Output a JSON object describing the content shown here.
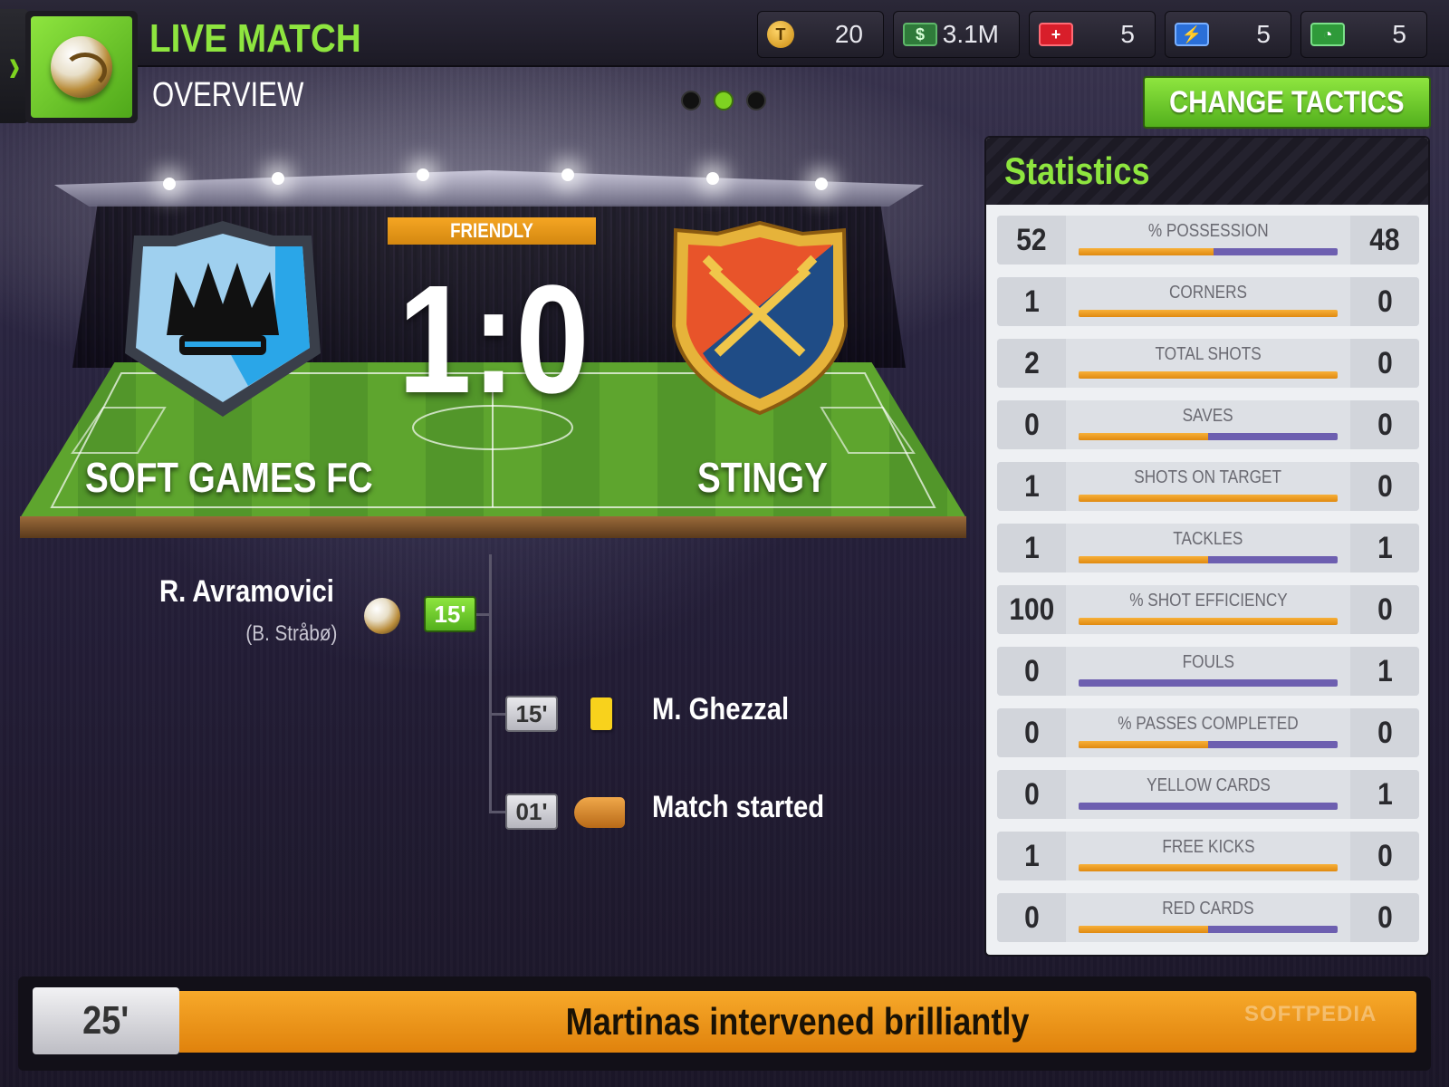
{
  "header": {
    "title": "LIVE MATCH",
    "subtitle": "OVERVIEW",
    "resources": [
      {
        "icon": "token-coin-icon",
        "value": "20"
      },
      {
        "icon": "cash-icon",
        "value": "3.1M"
      },
      {
        "icon": "medical-kit-icon",
        "value": "5"
      },
      {
        "icon": "energy-icon",
        "value": "5"
      },
      {
        "icon": "clock-icon",
        "value": "5"
      }
    ],
    "page_indicator": {
      "count": 3,
      "active_index": 1
    },
    "change_tactics_label": "CHANGE TACTICS"
  },
  "match": {
    "type": "FRIENDLY",
    "score": "1:0",
    "home_team": "SOFT GAMES FC",
    "away_team": "STINGY"
  },
  "timeline": [
    {
      "minute": "15'",
      "side": "home",
      "event": "goal",
      "player": "R. Avramovici",
      "assist": "(B. Stråbø)",
      "icon": "ball-icon"
    },
    {
      "minute": "15'",
      "side": "away",
      "event": "yellow-card",
      "player": "M. Ghezzal",
      "icon": "yellow-card-icon"
    },
    {
      "minute": "01'",
      "side": "away",
      "event": "kickoff",
      "player": "Match started",
      "icon": "whistle-icon"
    }
  ],
  "statistics": {
    "title": "Statistics",
    "rows": [
      {
        "label": "% POSSESSION",
        "home": "52",
        "away": "48",
        "home_share": 0.52
      },
      {
        "label": "CORNERS",
        "home": "1",
        "away": "0",
        "home_share": 1.0
      },
      {
        "label": "TOTAL SHOTS",
        "home": "2",
        "away": "0",
        "home_share": 1.0
      },
      {
        "label": "SAVES",
        "home": "0",
        "away": "0",
        "home_share": 0.5
      },
      {
        "label": "SHOTS ON TARGET",
        "home": "1",
        "away": "0",
        "home_share": 1.0
      },
      {
        "label": "TACKLES",
        "home": "1",
        "away": "1",
        "home_share": 0.5
      },
      {
        "label": "% SHOT EFFICIENCY",
        "home": "100",
        "away": "0",
        "home_share": 1.0
      },
      {
        "label": "FOULS",
        "home": "0",
        "away": "1",
        "home_share": 0.0
      },
      {
        "label": "% PASSES COMPLETED",
        "home": "0",
        "away": "0",
        "home_share": 0.5
      },
      {
        "label": "YELLOW CARDS",
        "home": "0",
        "away": "1",
        "home_share": 0.0
      },
      {
        "label": "FREE KICKS",
        "home": "1",
        "away": "0",
        "home_share": 1.0
      },
      {
        "label": "RED CARDS",
        "home": "0",
        "away": "0",
        "home_share": 0.5
      }
    ]
  },
  "ticker": {
    "minute": "25'",
    "text": "Martinas intervened brilliantly",
    "watermark": "SOFTPEDIA"
  },
  "colors": {
    "accent_green": "#8ee53f",
    "home_bar": "#e08a10",
    "away_bar": "#6d5fb0",
    "ticker_orange": "#f7a92a"
  }
}
